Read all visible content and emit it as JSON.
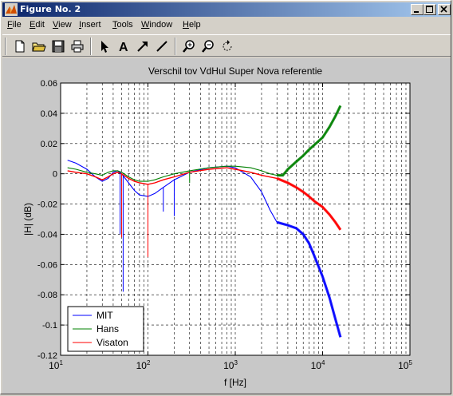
{
  "window": {
    "title": "Figure No. 2"
  },
  "menu": [
    {
      "label": "File",
      "ul": "F",
      "rest": "ile"
    },
    {
      "label": "Edit",
      "ul": "E",
      "rest": "dit"
    },
    {
      "label": "View",
      "ul": "V",
      "rest": "iew"
    },
    {
      "label": "Insert",
      "ul": "I",
      "rest": "nsert"
    },
    {
      "label": "Tools",
      "ul": "T",
      "rest": "ools"
    },
    {
      "label": "Window",
      "ul": "W",
      "rest": "indow"
    },
    {
      "label": "Help",
      "ul": "H",
      "rest": "elp"
    }
  ],
  "toolbar": [
    "new-file-icon",
    "open-folder-icon",
    "save-icon",
    "print-icon",
    "select-arrow-icon",
    "insert-text-icon",
    "insert-arrow-icon",
    "insert-line-icon",
    "zoom-in-icon",
    "zoom-out-icon",
    "rotate-icon"
  ],
  "colors": {
    "MIT": "#0000ff",
    "Hans": "#008000",
    "Visaton": "#ff0000"
  },
  "chart_data": {
    "type": "line",
    "title": "Verschil tov VdHul Super Nova referentie",
    "xlabel": "f [Hz]",
    "ylabel": "|H| (dB)",
    "xscale": "log",
    "xlim": [
      10,
      100000
    ],
    "ylim": [
      -0.12,
      0.06
    ],
    "grid": true,
    "legend_position": "bottom-left",
    "x_tick_labels": [
      "10^1",
      "10^2",
      "10^3",
      "10^4",
      "10^5"
    ],
    "y_tick_labels": [
      "0.06",
      "0.04",
      "0.02",
      "0",
      "-0.02",
      "-0.04",
      "-0.06",
      "-0.08",
      "-0.1",
      "-0.12"
    ],
    "series": [
      {
        "name": "MIT",
        "x": [
          12,
          15,
          20,
          25,
          30,
          35,
          40,
          45,
          50,
          60,
          70,
          80,
          100,
          120,
          150,
          200,
          300,
          500,
          800,
          1000,
          1500,
          2000,
          2500,
          3000,
          4000,
          5000,
          6000,
          7000,
          8000,
          10000,
          12000,
          14000,
          16000
        ],
        "y": [
          0.009,
          0.007,
          0.003,
          -0.002,
          -0.005,
          -0.003,
          0.001,
          0.002,
          0.0,
          -0.006,
          -0.011,
          -0.014,
          -0.015,
          -0.013,
          -0.009,
          -0.004,
          0.001,
          0.004,
          0.005,
          0.004,
          -0.002,
          -0.012,
          -0.024,
          -0.032,
          -0.034,
          -0.036,
          -0.04,
          -0.046,
          -0.054,
          -0.068,
          -0.082,
          -0.096,
          -0.108
        ]
      },
      {
        "name": "Hans",
        "x": [
          12,
          15,
          20,
          25,
          30,
          35,
          40,
          45,
          50,
          60,
          70,
          80,
          100,
          120,
          150,
          200,
          300,
          500,
          800,
          1000,
          1500,
          2000,
          2500,
          3000,
          3500,
          4000,
          5000,
          6000,
          7000,
          8000,
          10000,
          12000,
          14000,
          16000
        ],
        "y": [
          0.004,
          0.003,
          0.001,
          0.0,
          -0.001,
          0.001,
          0.002,
          0.002,
          0.001,
          -0.002,
          -0.004,
          -0.005,
          -0.005,
          -0.004,
          -0.002,
          0.0,
          0.002,
          0.004,
          0.005,
          0.005,
          0.004,
          0.002,
          0.0,
          -0.001,
          -0.001,
          0.003,
          0.008,
          0.012,
          0.016,
          0.019,
          0.024,
          0.031,
          0.038,
          0.045
        ]
      },
      {
        "name": "Visaton",
        "x": [
          12,
          15,
          20,
          25,
          30,
          35,
          40,
          45,
          50,
          60,
          70,
          80,
          100,
          120,
          150,
          200,
          300,
          500,
          800,
          1000,
          1500,
          2000,
          3000,
          4000,
          5000,
          6000,
          7000,
          8000,
          10000,
          12000,
          14000,
          16000
        ],
        "y": [
          0.002,
          0.001,
          0.0,
          -0.002,
          -0.004,
          -0.002,
          0.0,
          0.001,
          0.0,
          -0.003,
          -0.005,
          -0.006,
          -0.007,
          -0.006,
          -0.004,
          -0.002,
          0.001,
          0.003,
          0.004,
          0.003,
          0.001,
          -0.001,
          -0.003,
          -0.006,
          -0.009,
          -0.012,
          -0.015,
          -0.018,
          -0.022,
          -0.027,
          -0.032,
          -0.037
        ]
      }
    ],
    "spikes": [
      {
        "series": "MIT",
        "x": 48,
        "to_y": -0.04
      },
      {
        "series": "MIT",
        "x": 52,
        "to_y": -0.078
      },
      {
        "series": "Visaton",
        "x": 50,
        "to_y": -0.042
      },
      {
        "series": "MIT",
        "x": 100,
        "to_y": -0.048
      },
      {
        "series": "Visaton",
        "x": 100,
        "to_y": -0.055
      },
      {
        "series": "MIT",
        "x": 150,
        "to_y": -0.025
      },
      {
        "series": "MIT",
        "x": 200,
        "to_y": -0.028
      },
      {
        "series": "Hans",
        "x": 300,
        "to_y": -0.006
      }
    ]
  }
}
